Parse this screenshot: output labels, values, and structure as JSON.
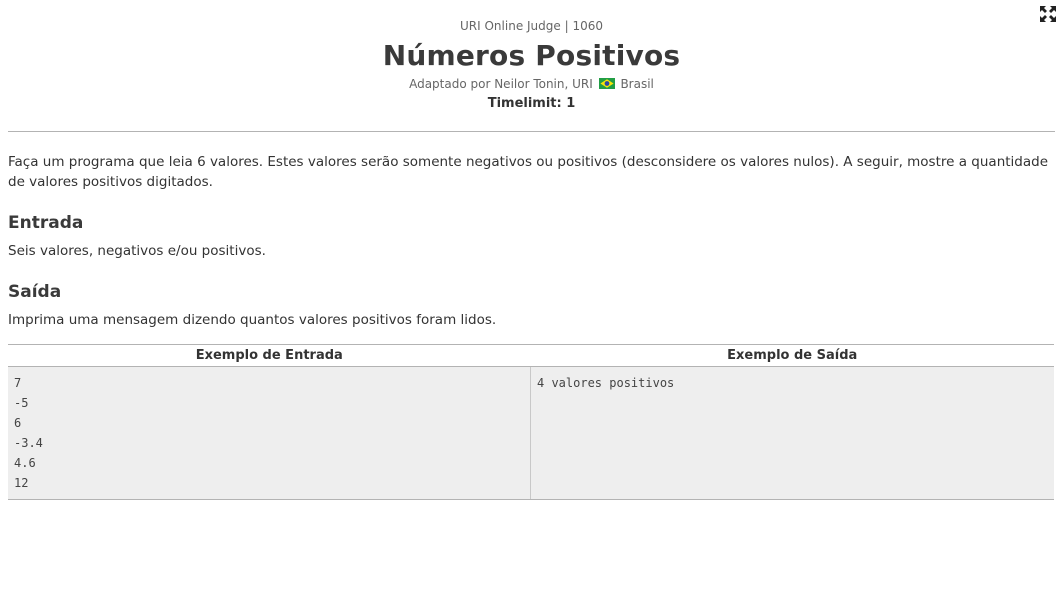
{
  "header": {
    "judge": "URI Online Judge | 1060",
    "title": "Números Positivos",
    "author_prefix": "Adaptado por Neilor Tonin, URI",
    "country": "Brasil",
    "timelimit": "Timelimit: 1"
  },
  "problem": {
    "description": "Faça um programa que leia 6 valores. Estes valores serão somente negativos ou positivos (desconsidere os valores nulos). A seguir, mostre a quantidade de valores positivos digitados.",
    "input_heading": "Entrada",
    "input_text": "Seis valores, negativos e/ou positivos.",
    "output_heading": "Saída",
    "output_text": "Imprima uma mensagem dizendo quantos valores positivos foram lidos."
  },
  "examples": {
    "input_header": "Exemplo de Entrada",
    "output_header": "Exemplo de Saída",
    "input_lines": [
      "7",
      "-5",
      "6",
      "-3.4",
      "4.6",
      "12"
    ],
    "output_lines": [
      "4 valores positivos"
    ]
  },
  "icons": {
    "expand": "expand-arrows-icon",
    "flag": "brazil-flag-icon"
  }
}
